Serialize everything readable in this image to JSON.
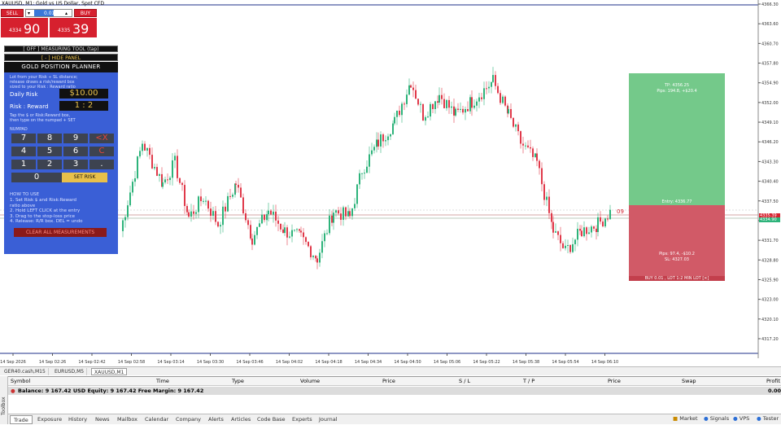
{
  "window_title": "XAUUSD, M1: Gold vs US Dollar, Spot CFD",
  "trade_panel": {
    "sell_label": "SELL",
    "buy_label": "BUY",
    "lot_value": "0.01",
    "bid_small": "4334",
    "bid_big": "90",
    "ask_small": "4335",
    "ask_big": "39"
  },
  "planner": {
    "measuring_tool": "[ OFF ]   MEASURING TOOL  (tap)",
    "hide_panel": "[ - ]  HIDE PANEL",
    "title": "GOLD POSITION PLANNER",
    "desc1": "Lot from your Risk ÷ SL distance;",
    "desc2": "release draws a risk/reward box",
    "desc3": "sized to your Risk : Reward ratio",
    "daily_risk_label": "Daily Risk",
    "daily_risk_value": "$10.00",
    "rr_label": "Risk : Reward",
    "rr_value": "1 : 2",
    "hint1": "Tap the $ or Risk:Reward box,",
    "hint2": "then type on the numpad + SET",
    "numpad_label": "NUMPAD",
    "keys": [
      "7",
      "8",
      "9",
      "<X",
      "4",
      "5",
      "6",
      "C",
      "1",
      "2",
      "3",
      ".",
      "0"
    ],
    "set_risk": "SET RISK",
    "howto_title": "HOW TO USE",
    "howto1": "1. Set Risk $ and Risk:Reward",
    "howto1b": "   ratio above",
    "howto2": "2. Hold LEFT CLICK at the entry",
    "howto3": "3. Drag to the stop-loss price",
    "howto4": "4. Release: R/R box.  DEL = undo",
    "clear_all": "CLEAR ALL MEASUREMENTS"
  },
  "rr_box": {
    "tp_line1": "TP: 4356.25",
    "tp_line2": "Pips: 194.8, +$20.4",
    "entry": "Entry: 4336.77",
    "sl_line1": "Pips: 97.4, -$10.2",
    "sl_line2": "SL: 4327.03",
    "bottom": "BUY  0.01 , LOT 1:2  MIN LOT [×]",
    "tag": "09"
  },
  "price_axis": [
    "4366.30",
    "4363.60",
    "4360.70",
    "4357.80",
    "4354.90",
    "4352.00",
    "4349.10",
    "4346.20",
    "4343.30",
    "4340.40",
    "4337.50",
    "4334.60",
    "4331.70",
    "4328.80",
    "4325.90",
    "4323.00",
    "4320.10",
    "4317.20"
  ],
  "price_tags": {
    "ask": "4335.39",
    "bid": "4334.90"
  },
  "time_axis": [
    "14 Sep 2026",
    "14 Sep 02:26",
    "14 Sep 02:42",
    "14 Sep 02:58",
    "14 Sep 03:14",
    "14 Sep 03:30",
    "14 Sep 03:46",
    "14 Sep 04:02",
    "14 Sep 04:18",
    "14 Sep 04:34",
    "14 Sep 04:50",
    "14 Sep 05:06",
    "14 Sep 05:22",
    "14 Sep 05:38",
    "14 Sep 05:54",
    "14 Sep 06:10"
  ],
  "chart_tabs": [
    "GER40.cash,M15",
    "EURUSD,M5",
    "XAUUSD,M1"
  ],
  "table": {
    "headers": [
      "Symbol",
      "Time",
      "Type",
      "Volume",
      "Price",
      "S / L",
      "T / P",
      "Price",
      "Swap",
      "Profit"
    ],
    "balance_row": "Balance: 9 167.42 USD   Equity: 9 167.42   Free Margin: 9 167.42",
    "profit": "0.00"
  },
  "bottom_tabs": [
    "Trade",
    "Exposure",
    "History",
    "News",
    "Mailbox",
    "Calendar",
    "Company",
    "Alerts",
    "Articles",
    "Code Base",
    "Experts",
    "Journal"
  ],
  "toolbox_label": "Toolbox",
  "status_right": [
    "Market",
    "Signals",
    "VPS",
    "Tester"
  ],
  "colors": {
    "bull": "#2db37a",
    "bear": "#e0394a",
    "tp": "#74c98a",
    "sl": "#d15a67",
    "panel": "#3a5fd6"
  }
}
